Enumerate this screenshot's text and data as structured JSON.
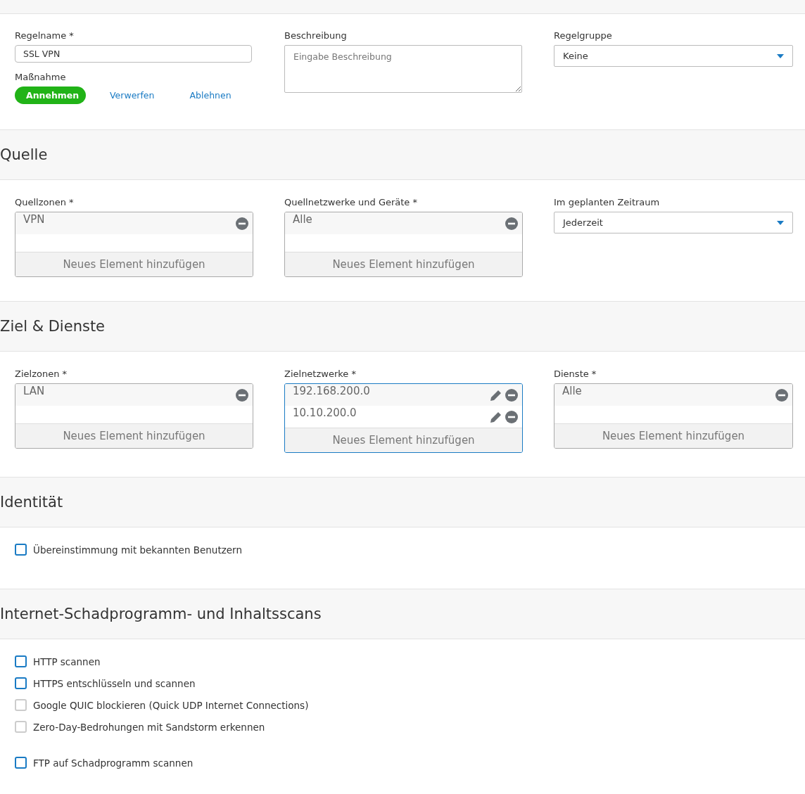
{
  "general": {
    "rule_name": {
      "label": "Regelname *",
      "value": "SSL VPN"
    },
    "action": {
      "label": "Maßnahme",
      "options": [
        {
          "label": "Annehmen",
          "selected": true
        },
        {
          "label": "Verwerfen",
          "selected": false
        },
        {
          "label": "Ablehnen",
          "selected": false
        }
      ]
    },
    "description": {
      "label": "Beschreibung",
      "placeholder": "Eingabe Beschreibung"
    },
    "rule_group": {
      "label": "Regelgruppe",
      "value": "Keine"
    }
  },
  "sections": [
    {
      "title": "Quelle",
      "kind": "fields",
      "fields": [
        {
          "kind": "list",
          "label": "Quellzonen *",
          "focused": false,
          "items": [
            {
              "text": "VPN",
              "editable": false
            }
          ],
          "add_label": "Neues Element hinzufügen"
        },
        {
          "kind": "list",
          "label": "Quellnetzwerke und Geräte *",
          "focused": false,
          "items": [
            {
              "text": "Alle",
              "editable": false
            }
          ],
          "add_label": "Neues Element hinzufügen"
        },
        {
          "kind": "select",
          "label": "Im geplanten Zeitraum",
          "value": "Jederzeit"
        }
      ]
    },
    {
      "title": "Ziel & Dienste",
      "kind": "fields",
      "fields": [
        {
          "kind": "list",
          "label": "Zielzonen *",
          "focused": false,
          "items": [
            {
              "text": "LAN",
              "editable": false
            }
          ],
          "add_label": "Neues Element hinzufügen"
        },
        {
          "kind": "list",
          "label": "Zielnetzwerke *",
          "focused": true,
          "items": [
            {
              "text": "192.168.200.0",
              "editable": true
            },
            {
              "text": "10.10.200.0",
              "editable": true
            }
          ],
          "add_label": "Neues Element hinzufügen"
        },
        {
          "kind": "list",
          "label": "Dienste *",
          "focused": false,
          "items": [
            {
              "text": "Alle",
              "editable": false
            }
          ],
          "add_label": "Neues Element hinzufügen"
        }
      ]
    },
    {
      "title": "Identität",
      "kind": "checks",
      "groups": [
        {
          "checks": [
            {
              "label": "Übereinstimmung mit bekannten Benutzern",
              "checked": false,
              "disabled": false
            }
          ]
        }
      ]
    },
    {
      "title": "Internet-Schadprogramm- und Inhaltsscans",
      "kind": "checks",
      "groups": [
        {
          "checks": [
            {
              "label": "HTTP scannen",
              "checked": false,
              "disabled": false
            },
            {
              "label": "HTTPS entschlüsseln und scannen",
              "checked": false,
              "disabled": false
            },
            {
              "label": "Google QUIC blockieren (Quick UDP Internet Connections)",
              "checked": false,
              "disabled": true
            },
            {
              "label": "Zero-Day-Bedrohungen mit Sandstorm erkennen",
              "checked": false,
              "disabled": true
            }
          ]
        },
        {
          "checks": [
            {
              "label": "FTP auf Schadprogramm scannen",
              "checked": false,
              "disabled": false
            }
          ]
        }
      ]
    }
  ]
}
